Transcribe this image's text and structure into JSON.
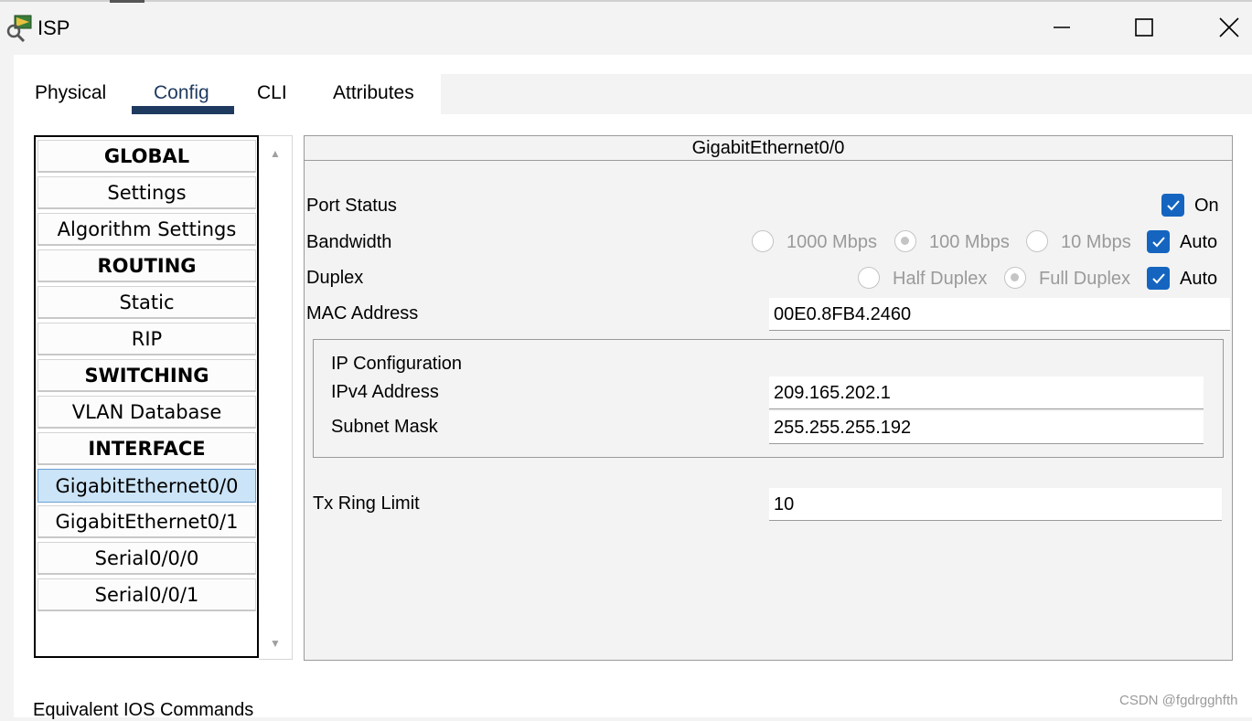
{
  "window": {
    "title": "ISP"
  },
  "tabs": [
    "Physical",
    "Config",
    "CLI",
    "Attributes"
  ],
  "active_tab": "Config",
  "sidebar": {
    "items": [
      {
        "label": "GLOBAL",
        "header": true
      },
      {
        "label": "Settings"
      },
      {
        "label": "Algorithm Settings"
      },
      {
        "label": "ROUTING",
        "header": true
      },
      {
        "label": "Static"
      },
      {
        "label": "RIP"
      },
      {
        "label": "SWITCHING",
        "header": true
      },
      {
        "label": "VLAN Database"
      },
      {
        "label": "INTERFACE",
        "header": true
      },
      {
        "label": "GigabitEthernet0/0",
        "selected": true
      },
      {
        "label": "GigabitEthernet0/1"
      },
      {
        "label": "Serial0/0/0"
      },
      {
        "label": "Serial0/0/1"
      }
    ]
  },
  "panel": {
    "title": "GigabitEthernet0/0",
    "port_status": {
      "label": "Port Status",
      "on_label": "On",
      "checked": true
    },
    "bandwidth": {
      "label": "Bandwidth",
      "options": [
        "1000 Mbps",
        "100 Mbps",
        "10 Mbps"
      ],
      "selected": "100 Mbps",
      "auto_label": "Auto",
      "auto_checked": true
    },
    "duplex": {
      "label": "Duplex",
      "options": [
        "Half Duplex",
        "Full Duplex"
      ],
      "selected": "Full Duplex",
      "auto_label": "Auto",
      "auto_checked": true
    },
    "mac": {
      "label": "MAC Address",
      "value": "00E0.8FB4.2460"
    },
    "ip_config": {
      "title": "IP Configuration",
      "ipv4_label": "IPv4 Address",
      "ipv4_value": "209.165.202.1",
      "mask_label": "Subnet Mask",
      "mask_value": "255.255.255.192"
    },
    "tx_ring": {
      "label": "Tx Ring Limit",
      "value": "10"
    }
  },
  "footer": {
    "ios_label": "Equivalent IOS Commands"
  },
  "watermark": "CSDN @fgdrgghfth",
  "colors": {
    "accent": "#1565c0",
    "selected_bg": "#cce4f7",
    "tab_underline": "#1f3a5f"
  },
  "icons": {
    "app": "router-icon",
    "minimize": "minimize-icon",
    "maximize": "maximize-icon",
    "close": "close-icon"
  }
}
